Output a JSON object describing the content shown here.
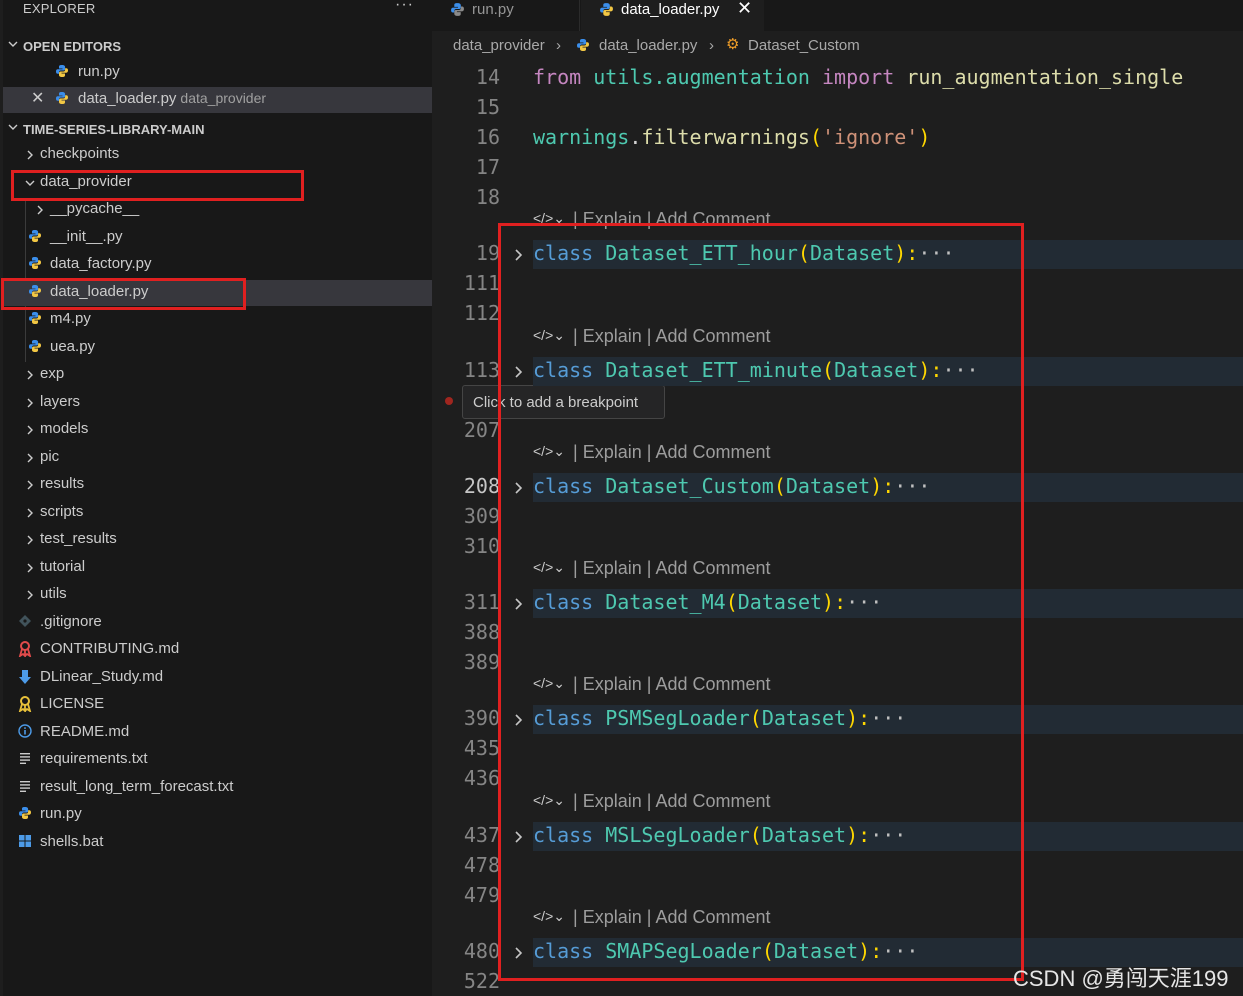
{
  "sidebar": {
    "title": "EXPLORER",
    "more_label": "···",
    "open_editors": {
      "heading": "OPEN EDITORS",
      "items": [
        {
          "name": "run.py",
          "desc": ""
        },
        {
          "name": "data_loader.py",
          "desc": "data_provider"
        }
      ]
    },
    "project": {
      "heading": "TIME-SERIES-LIBRARY-MAIN",
      "items": [
        {
          "name": "checkpoints",
          "kind": "folder",
          "icon": "chevron-right-icon"
        },
        {
          "name": "data_provider",
          "kind": "folder-open",
          "icon": "chevron-down-icon"
        },
        {
          "name": "__pycache__",
          "kind": "folder",
          "icon": "chevron-right-icon"
        },
        {
          "name": "__init__.py",
          "kind": "python",
          "icon": "python-icon"
        },
        {
          "name": "data_factory.py",
          "kind": "python",
          "icon": "python-icon"
        },
        {
          "name": "data_loader.py",
          "kind": "python",
          "icon": "python-icon"
        },
        {
          "name": "m4.py",
          "kind": "python",
          "icon": "python-icon"
        },
        {
          "name": "uea.py",
          "kind": "python",
          "icon": "python-icon"
        },
        {
          "name": "exp",
          "kind": "folder",
          "icon": "chevron-right-icon"
        },
        {
          "name": "layers",
          "kind": "folder",
          "icon": "chevron-right-icon"
        },
        {
          "name": "models",
          "kind": "folder",
          "icon": "chevron-right-icon"
        },
        {
          "name": "pic",
          "kind": "folder",
          "icon": "chevron-right-icon"
        },
        {
          "name": "results",
          "kind": "folder",
          "icon": "chevron-right-icon"
        },
        {
          "name": "scripts",
          "kind": "folder",
          "icon": "chevron-right-icon"
        },
        {
          "name": "test_results",
          "kind": "folder",
          "icon": "chevron-right-icon"
        },
        {
          "name": "tutorial",
          "kind": "folder",
          "icon": "chevron-right-icon"
        },
        {
          "name": "utils",
          "kind": "folder",
          "icon": "chevron-right-icon"
        },
        {
          "name": ".gitignore",
          "kind": "file",
          "icon": "git-icon"
        },
        {
          "name": "CONTRIBUTING.md",
          "kind": "file",
          "icon": "ribbon-icon"
        },
        {
          "name": "DLinear_Study.md",
          "kind": "file",
          "icon": "markdown-icon"
        },
        {
          "name": "LICENSE",
          "kind": "file",
          "icon": "license-icon"
        },
        {
          "name": "README.md",
          "kind": "file",
          "icon": "info-icon"
        },
        {
          "name": "requirements.txt",
          "kind": "file",
          "icon": "text-file-icon"
        },
        {
          "name": "result_long_term_forecast.txt",
          "kind": "file",
          "icon": "text-file-icon"
        },
        {
          "name": "run.py",
          "kind": "python",
          "icon": "python-icon"
        },
        {
          "name": "shells.bat",
          "kind": "file",
          "icon": "windows-icon"
        }
      ]
    }
  },
  "tabs": [
    {
      "label": "run.py",
      "active": false
    },
    {
      "label": "data_loader.py",
      "active": true,
      "close": "✕"
    }
  ],
  "breadcrumb": {
    "folder": "data_provider",
    "file": "data_loader.py",
    "symbol": "Dataset_Custom"
  },
  "editor": {
    "line_numbers": [
      "14",
      "15",
      "16",
      "17",
      "18",
      "19",
      "111",
      "112",
      "113",
      "207",
      "208",
      "309",
      "310",
      "311",
      "388",
      "389",
      "390",
      "435",
      "436",
      "437",
      "478",
      "479",
      "480",
      "522"
    ],
    "line14": {
      "from": "from",
      "module": "utils.augmentation",
      "import": "import",
      "name": "run_augmentation_single"
    },
    "line16": {
      "obj": "warnings",
      "dot": ".",
      "fn": "filterwarnings",
      "open": "(",
      "arg": "'ignore'",
      "close": ")"
    },
    "codelens": {
      "explain": "Explain",
      "sep": "|",
      "add_comment": "Add Comment"
    },
    "classes": [
      {
        "keyword": "class",
        "name": "Dataset_ETT_hour",
        "base": "Dataset"
      },
      {
        "keyword": "class",
        "name": "Dataset_ETT_minute",
        "base": "Dataset"
      },
      {
        "keyword": "class",
        "name": "Dataset_Custom",
        "base": "Dataset"
      },
      {
        "keyword": "class",
        "name": "Dataset_M4",
        "base": "Dataset"
      },
      {
        "keyword": "class",
        "name": "PSMSegLoader",
        "base": "Dataset"
      },
      {
        "keyword": "class",
        "name": "MSLSegLoader",
        "base": "Dataset"
      },
      {
        "keyword": "class",
        "name": "SMAPSegLoader",
        "base": "Dataset"
      }
    ],
    "fold_suffix": "):",
    "ellipsis": "···",
    "tooltip": "Click to add a breakpoint"
  },
  "watermark": "CSDN @勇闯天涯199",
  "colors": {
    "keyword": "#569cd6",
    "type": "#4ec9b0",
    "function": "#dcdcaa",
    "string": "#ce9178",
    "bracket": "#ffd700",
    "python_icon": "#3b8eea",
    "annotation_red": "#e02020"
  }
}
